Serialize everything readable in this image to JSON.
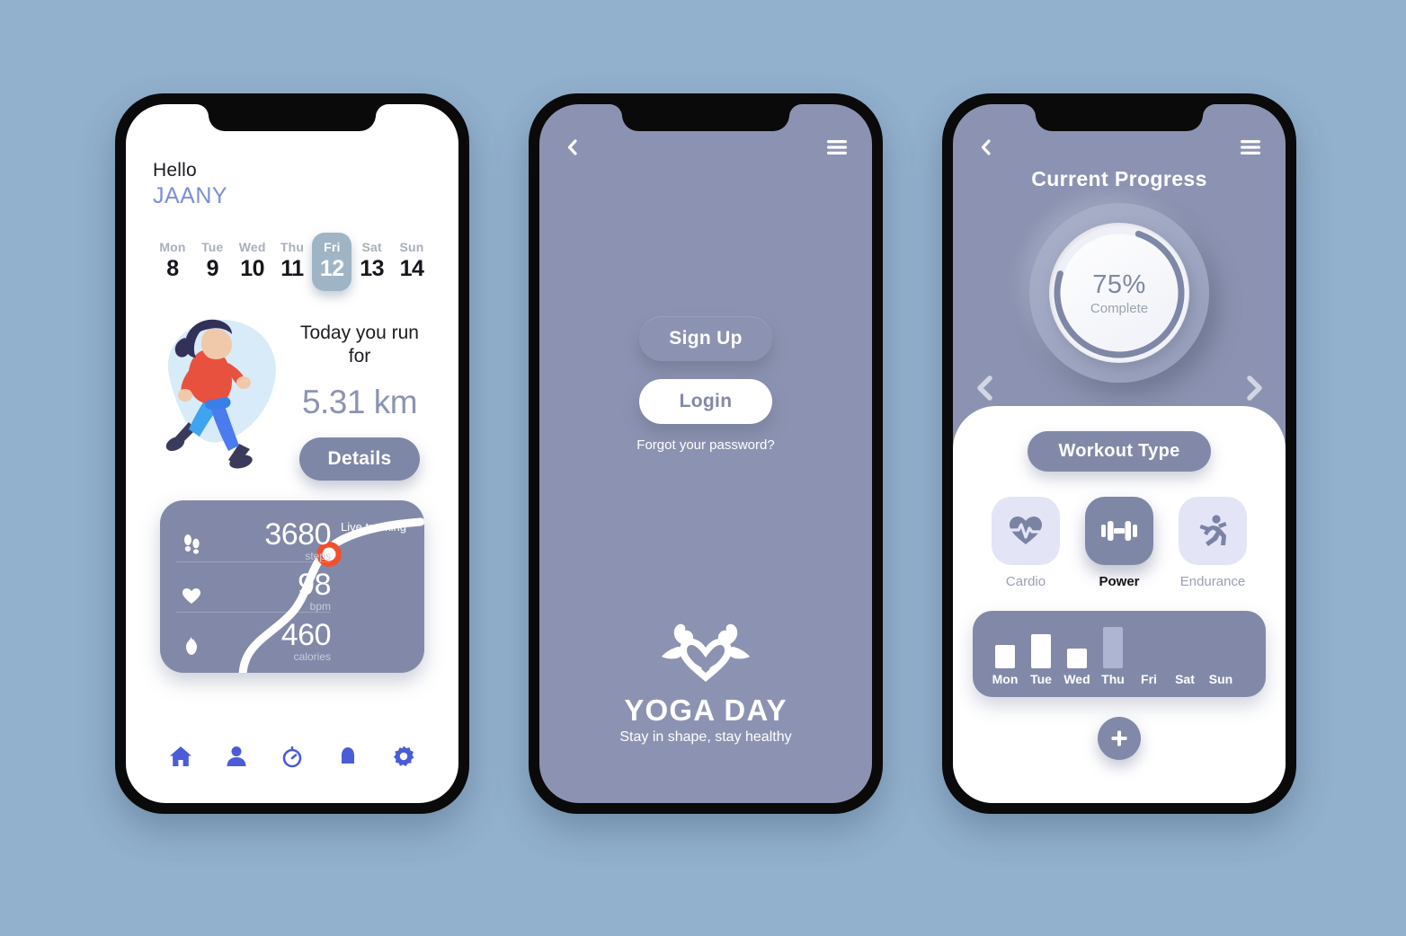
{
  "canvas": {
    "background_color": "#92b1cd",
    "screen_purple": "#8c93b2",
    "accent_indigo": "#4a5cd6",
    "accent_red": "#f1502f"
  },
  "phone1": {
    "greeting": "Hello",
    "user_name": "JAANY",
    "day_selector": {
      "days": [
        {
          "name": "Mon",
          "num": "8",
          "active": false
        },
        {
          "name": "Tue",
          "num": "9",
          "active": false
        },
        {
          "name": "Wed",
          "num": "10",
          "active": false
        },
        {
          "name": "Thu",
          "num": "11",
          "active": false
        },
        {
          "name": "Fri",
          "num": "12",
          "active": true
        },
        {
          "name": "Sat",
          "num": "13",
          "active": false
        },
        {
          "name": "Sun",
          "num": "14",
          "active": false
        }
      ]
    },
    "run_summary": {
      "caption": "Today you run for",
      "distance": "5.31 km",
      "details_label": "Details"
    },
    "stats_card": {
      "live_label": "Live tracking",
      "rows": [
        {
          "icon": "footsteps-icon",
          "value": "3680",
          "unit": "steps"
        },
        {
          "icon": "heart-icon",
          "value": "98",
          "unit": "bpm"
        },
        {
          "icon": "flame-icon",
          "value": "460",
          "unit": "calories"
        }
      ]
    },
    "bottom_nav": [
      {
        "icon": "home-icon"
      },
      {
        "icon": "person-icon"
      },
      {
        "icon": "stopwatch-icon"
      },
      {
        "icon": "bell-icon"
      },
      {
        "icon": "gear-icon"
      }
    ]
  },
  "phone2": {
    "topbar": {
      "back_icon": "chevron-left-icon",
      "menu_icon": "hamburger-menu-icon"
    },
    "signup_label": "Sign Up",
    "login_label": "Login",
    "forgot_label": "Forgot your password?",
    "logo": {
      "icon": "heart-muscle-arms-icon",
      "title": "YOGA DAY",
      "subtitle": "Stay in shape, stay healthy"
    }
  },
  "phone3": {
    "topbar": {
      "back_icon": "chevron-left-icon",
      "menu_icon": "hamburger-menu-icon"
    },
    "title": "Current Progress",
    "progress": {
      "percent_label": "75%",
      "sub_label": "Complete",
      "percent_value": 75,
      "prev_icon": "chevron-left-icon",
      "next_icon": "chevron-right-icon"
    },
    "workout_type_label": "Workout Type",
    "workout_types": [
      {
        "label": "Cardio",
        "icon": "heart-pulse-icon",
        "selected": false
      },
      {
        "label": "Power",
        "icon": "dumbbell-icon",
        "selected": true
      },
      {
        "label": "Endurance",
        "icon": "runner-icon",
        "selected": false
      }
    ],
    "add_label": "+",
    "week_chart": {
      "type": "bar",
      "categories": [
        "Mon",
        "Tue",
        "Wed",
        "Thu",
        "Fri",
        "Sat",
        "Sun"
      ],
      "values": [
        26,
        38,
        22,
        46,
        0,
        0,
        0
      ],
      "states": [
        "filled",
        "filled",
        "filled",
        "highlight",
        "empty",
        "empty",
        "empty"
      ],
      "title": "",
      "xlabel": "",
      "ylabel": "",
      "ylim": [
        0,
        50
      ]
    }
  }
}
